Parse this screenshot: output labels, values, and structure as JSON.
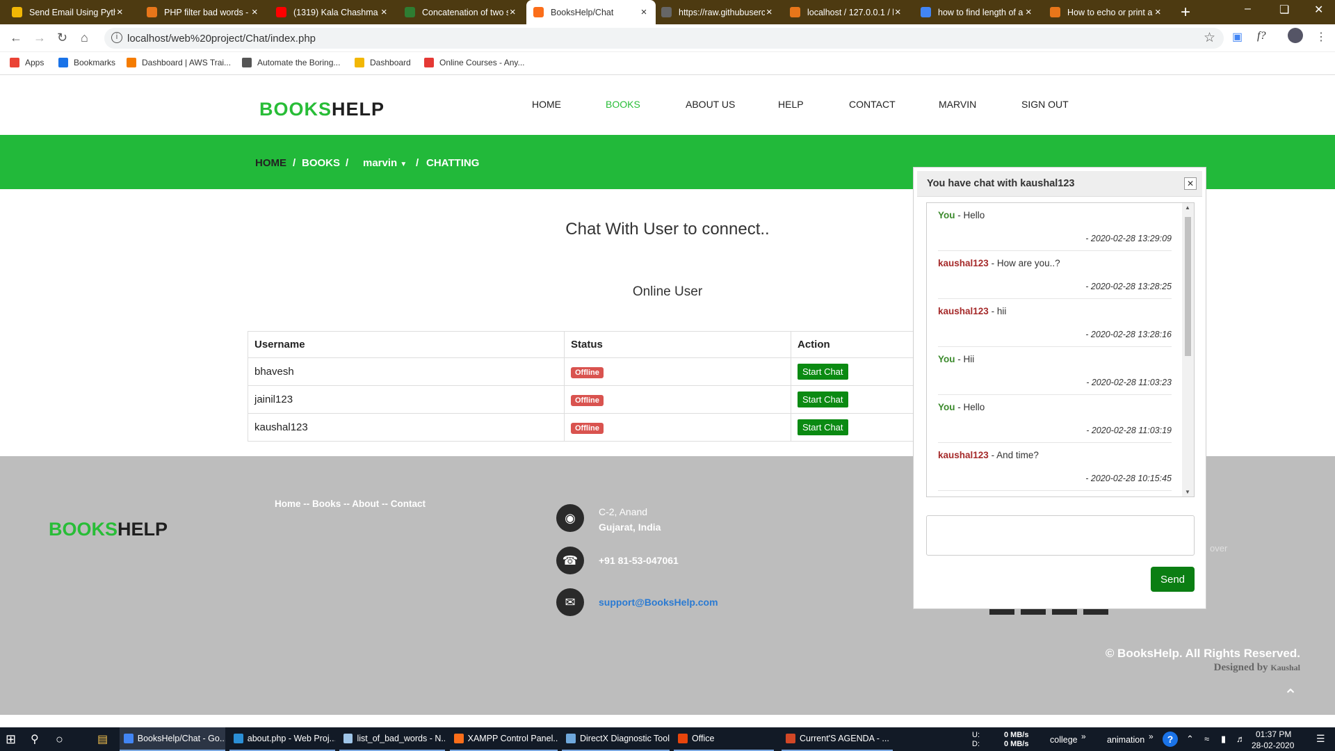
{
  "browser": {
    "tabs": [
      {
        "title": "Send Email Using Pytho",
        "icon_color": "#f2b705"
      },
      {
        "title": "PHP filter bad words -",
        "icon_color": "#e8761a"
      },
      {
        "title": "(1319) Kala Chashma |",
        "icon_color": "#ff0000"
      },
      {
        "title": "Concatenation of two s",
        "icon_color": "#2e7d32"
      },
      {
        "title": "BooksHelp/Chat",
        "icon_color": "#fb6e1a"
      },
      {
        "title": "https://raw.githubuserc",
        "icon_color": "#666666"
      },
      {
        "title": "localhost / 127.0.0.1 / b",
        "icon_color": "#e8761a"
      },
      {
        "title": "how to find length of a",
        "icon_color": "#4285f4"
      },
      {
        "title": "How to echo or print a",
        "icon_color": "#e8761a"
      }
    ],
    "url": "localhost/web%20project/Chat/index.php",
    "bookmarks": [
      "Apps",
      "Bookmarks",
      "Dashboard | AWS Trai...",
      "Automate the Boring...",
      "Dashboard",
      "Online Courses - Any..."
    ]
  },
  "site": {
    "logo_a": "BOOKS",
    "logo_b": "HELP",
    "menu": [
      "HOME",
      "BOOKS",
      "ABOUT US",
      "HELP",
      "CONTACT",
      "MARVIN",
      "SIGN OUT"
    ],
    "active_menu": "BOOKS",
    "breadcrumb": {
      "home": "HOME",
      "sep": "/",
      "books": "BOOKS",
      "user": "marvin",
      "chat": "CHATTING"
    },
    "heading": "Chat With User to connect..",
    "subheading": "Online User",
    "table": {
      "headers": [
        "Username",
        "Status",
        "Action"
      ],
      "rows": [
        {
          "username": "bhavesh",
          "status": "Offline",
          "action": "Start Chat"
        },
        {
          "username": "jainil123",
          "status": "Offline",
          "action": "Start Chat"
        },
        {
          "username": "kaushal123",
          "status": "Offline",
          "action": "Start Chat"
        }
      ]
    }
  },
  "footer": {
    "logo_a": "BOOKS",
    "logo_b": "HELP",
    "links": "Home -- Books -- About -- Contact",
    "address_1": "C-2, Anand",
    "address_2": "Gujarat, India",
    "phone": "+91 81-53-047061",
    "email": "support@BooksHelp.com",
    "partial_text": "over",
    "copyright": "© BooksHelp. All Rights Reserved.",
    "designed_by": "Designed by",
    "designer": "Kaushal"
  },
  "chat": {
    "title": "You have chat with kaushal123",
    "messages": [
      {
        "sender": "You",
        "text": "- Hello",
        "time": "- 2020-02-28 13:29:09",
        "me": true
      },
      {
        "sender": "kaushal123",
        "text": "- How are you..?",
        "time": "- 2020-02-28 13:28:25",
        "me": false
      },
      {
        "sender": "kaushal123",
        "text": "- hii",
        "time": "- 2020-02-28 13:28:16",
        "me": false
      },
      {
        "sender": "You",
        "text": "- Hii",
        "time": "- 2020-02-28 11:03:23",
        "me": true
      },
      {
        "sender": "You",
        "text": "- Hello",
        "time": "- 2020-02-28 11:03:19",
        "me": true
      },
      {
        "sender": "kaushal123",
        "text": "- And time?",
        "time": "- 2020-02-28 10:15:45",
        "me": false
      }
    ],
    "input_value": "",
    "send_label": "Send"
  },
  "taskbar": {
    "apps": [
      "BooksHelp/Chat - Go...",
      "about.php - Web Proj...",
      "list_of_bad_words - N...",
      "XAMPP Control Panel...",
      "DirectX Diagnostic Tool",
      "Office",
      "Current'S AGENDA - ..."
    ],
    "net_u_label": "U:",
    "net_d_label": "D:",
    "net_u": "0 MB/s",
    "net_d": "0 MB/s",
    "toolbar_1": "college",
    "toolbar_2": "animation",
    "time": "01:37 PM",
    "date": "28-02-2020"
  }
}
